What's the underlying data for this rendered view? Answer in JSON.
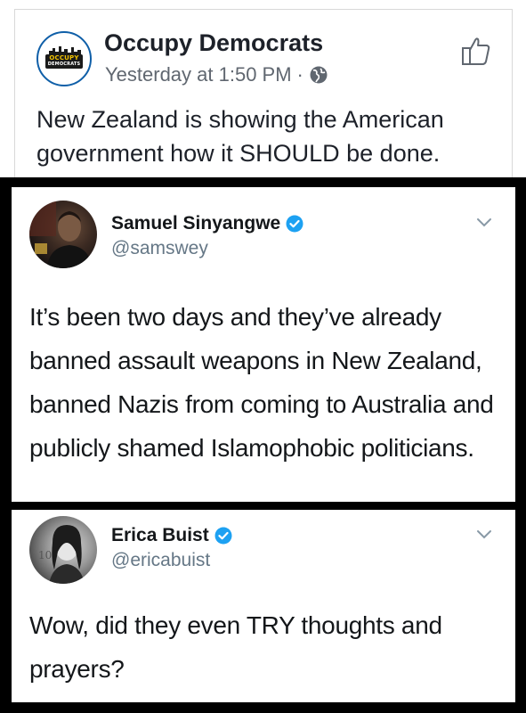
{
  "facebook_post": {
    "page_name": "Occupy Democrats",
    "timestamp": "Yesterday at 1:50 PM",
    "separator": "·",
    "avatar_logo": {
      "line1": "OCCUPY",
      "line2": "DEMOCRATS"
    },
    "text": "New Zealand is showing the American government how it SHOULD be done.",
    "icons": {
      "privacy": "globe-icon",
      "like": "thumbs-up-icon"
    }
  },
  "tweets": [
    {
      "display_name": "Samuel Sinyangwe",
      "handle": "@samswey",
      "verified": true,
      "text": "It’s been two days and they’ve already banned assault weapons in New Zealand, banned Nazis from coming to Australia and publicly shamed Islamophobic politicians."
    },
    {
      "display_name": "Erica Buist",
      "handle": "@ericabuist",
      "verified": true,
      "text": "Wow, did they even TRY thoughts and prayers?"
    }
  ],
  "colors": {
    "facebook_text": "#1d2129",
    "facebook_meta": "#606770",
    "twitter_verified": "#1da1f2",
    "frame": "#000000"
  }
}
